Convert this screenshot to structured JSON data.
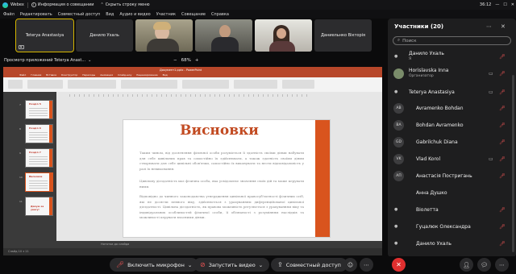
{
  "titlebar": {
    "app": "Webex",
    "meeting_info": "Информация о совещании",
    "hide_menu": "Скрыть строку меню",
    "time": "36:12"
  },
  "menu": [
    "Файл",
    "Редактировать",
    "Совместный доступ",
    "Вид",
    "Аудио и видео",
    "Участник",
    "Совещание",
    "Справка"
  ],
  "tiles": [
    {
      "name": "Teterya Anastasiya",
      "kind": "name"
    },
    {
      "name": "Данило Ухаль",
      "kind": "name"
    },
    {
      "name": "",
      "kind": "photo"
    },
    {
      "name": "",
      "kind": "photo"
    },
    {
      "name": "",
      "kind": "photo"
    },
    {
      "name": "Даниельнко Вікторія",
      "kind": "name"
    }
  ],
  "share": {
    "header": "Просмотр приложений Teterya Anast...",
    "zoom": "68%",
    "zoom_minus": "−",
    "zoom_plus": "+"
  },
  "ppt": {
    "window_title": "Документ1.pptx - PowerPoint",
    "tabs": [
      "Файл",
      "Главная",
      "Вставка",
      "Конструктор",
      "Переходы",
      "Анимация",
      "Слайд-шоу",
      "Рецензирование",
      "Вид"
    ],
    "thumbnails": [
      {
        "num": "7",
        "title": "Розділ 5"
      },
      {
        "num": "8",
        "title": "Розділ 6"
      },
      {
        "num": "9",
        "title": "Розділ 7"
      },
      {
        "num": "10",
        "title": "Висновки"
      },
      {
        "num": "11",
        "title": "Дякую за увагу!"
      }
    ],
    "slide_title": "Висновки",
    "paragraph1": "Таким чином, від досягнення фізичної особи розуміється її здатність своїми діями набувати для себе цивільних прав та самостійно їх здійснювати, а також здатність своїми діями створювати для себе цивільні обов'язки, самостійно їх виконувати та нести відповідальність у разі їх невиконання.",
    "paragraph2": "Цивільну дієздатність має фізична особа, яка усвідомлює значення своїх дій та може керувати ними.",
    "paragraph3": "Відповідно до чинного законодавства утвердження цивільної правосуб'єктності фізичних осіб, які не досягли певного віку, здійснюється з урахуванням диференційованої цивільної дієздатності. Цивільна дієздатність, як правова можливість регулюється з урахуванням віку та індивідуальних особливостей фізичної особи, її обізнаності з розумінням наслідків та можливості керувати власними діями.",
    "notes": "Нотатки до слайда",
    "status": "Слайд 10 з 11"
  },
  "controls": {
    "mic": "Включить микрофон",
    "video": "Запустить видео",
    "share": "Совместный доступ"
  },
  "panel": {
    "title": "Участники (20)",
    "search_placeholder": "Поиск",
    "participants": [
      {
        "name": "Данило Ухаль",
        "sub": "Я",
        "avatar": "",
        "mic": "off",
        "cam": ""
      },
      {
        "name": "Horislavska Inna",
        "sub": "Организатор",
        "avatar": "",
        "mic": "off",
        "cam": "on"
      },
      {
        "name": "Teterya Anastasiya",
        "sub": "",
        "avatar": "",
        "mic": "off",
        "cam": "on"
      },
      {
        "name": "Avramenko Bohdan",
        "sub": "",
        "avatar": "AB",
        "mic": "off",
        "cam": ""
      },
      {
        "name": "Bohdan Avramenko",
        "sub": "",
        "avatar": "BA",
        "mic": "off",
        "cam": ""
      },
      {
        "name": "Gabrilchuk Diana",
        "sub": "",
        "avatar": "GD",
        "mic": "off",
        "cam": ""
      },
      {
        "name": "Vlad Korol",
        "sub": "",
        "avatar": "VK",
        "mic": "off",
        "cam": "on"
      },
      {
        "name": "Анастасія Постригань",
        "sub": "",
        "avatar": "АП",
        "mic": "off",
        "cam": ""
      },
      {
        "name": "Анна Душко",
        "sub": "",
        "avatar": "",
        "mic": "",
        "cam": ""
      },
      {
        "name": "Віолетта",
        "sub": "",
        "avatar": "",
        "mic": "off",
        "cam": ""
      },
      {
        "name": "Гуцалюк Олександра",
        "sub": "",
        "avatar": "",
        "mic": "off",
        "cam": ""
      },
      {
        "name": "Данило Ухаль",
        "sub": "",
        "avatar": "",
        "mic": "off",
        "cam": ""
      }
    ]
  },
  "colors": {
    "accent_red": "#e02f2f",
    "ppt_orange": "#d9541e",
    "slide_title": "#c24b22"
  }
}
